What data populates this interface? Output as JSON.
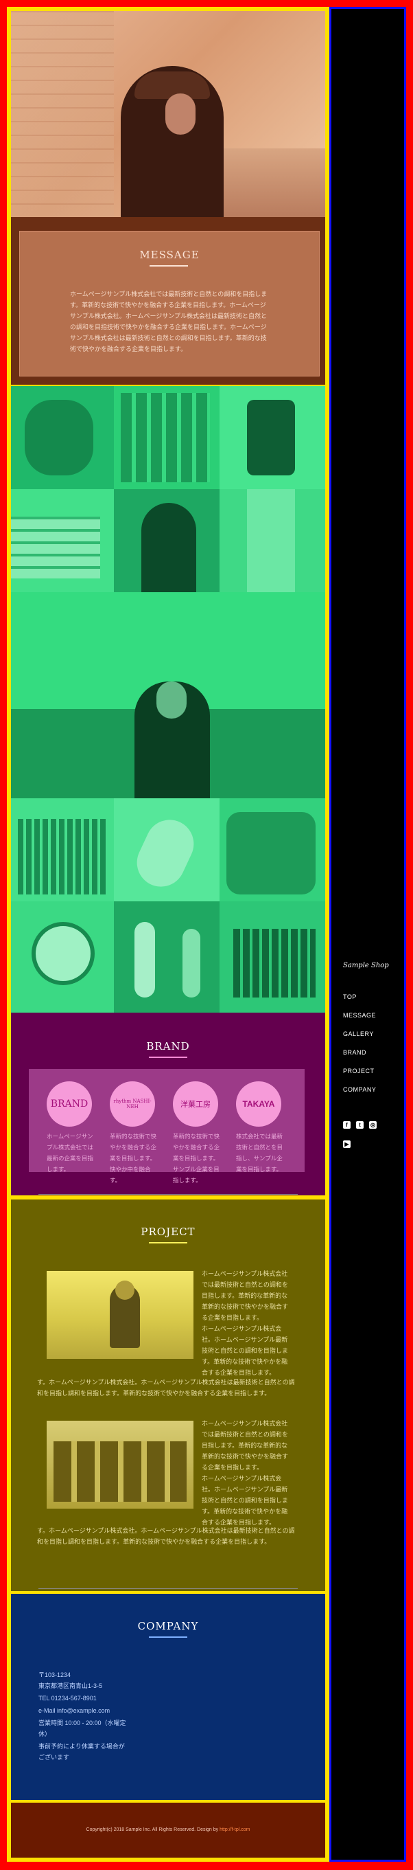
{
  "message": {
    "title": "MESSAGE",
    "body": "ホームページサンプル株式会社では最新技術と自然との調和を目指します。革新的な技術で快やかを融合する企業を目指します。ホームページサンプル株式会社。ホームページサンプル株式会社は最新技術と自然との調和を目指技術で快やかを融合する企業を目指します。ホームページサンプル株式会社は最新技術と自然との調和を目指します。革新的な技術で快やかを融合する企業を目指します。"
  },
  "brand": {
    "title": "BRAND",
    "items": [
      {
        "logo": "BRAND",
        "text": "ホームページサンプル株式会社では最新の企業を目指します。"
      },
      {
        "logo": "rhythm NASHI-NEH",
        "text": "革新的な技術で快やかを融合する企業を目指します。快やか中を融合す。"
      },
      {
        "logo": "洋菓工房",
        "text": "革新的な技術で快やかを融合する企業を目指します。サンプル企業を目指します。"
      },
      {
        "logo": "TAKAYA",
        "text": "株式会社では最新技術と自然とを目指し、サンプル企業を目指します。"
      }
    ]
  },
  "project": {
    "title": "PROJECT",
    "items": [
      {
        "side": "ホームページサンプル株式会社では最新技術と自然との調和を目指します。革新的な革新的な革新的な技術で快やかを融合する企業を目指します。\nホームページサンプル株式会社。ホームページサンプル最新技術と自然との調和を目指します。革新的な技術で快やかを融合する企業を目指します。",
        "full": "す。ホームページサンプル株式会社。ホームページサンプル株式会社は最新技術と自然との調和を目指し調和を目指します。革新的な技術で快やかを融合する企業を目指します。"
      },
      {
        "side": "ホームページサンプル株式会社では最新技術と自然との調和を目指します。革新的な革新的な革新的な技術で快やかを融合する企業を目指します。\nホームページサンプル株式会社。ホームページサンプル最新技術と自然との調和を目指します。革新的な技術で快やかを融合する企業を目指します。",
        "full": "す。ホームページサンプル株式会社。ホームページサンプル株式会社は最新技術と自然との調和を目指し調和を目指します。革新的な技術で快やかを融合する企業を目指します。"
      }
    ]
  },
  "company": {
    "title": "COMPANY",
    "postal": "〒103-1234",
    "address": "東京都港区南青山1-3-5",
    "tel": "TEL 01234-567-8901",
    "email": "e-Mail info@example.com",
    "hours": "営業時間 10:00 - 20:00（水曜定休）",
    "note": "事前予約により休業する場合がございます"
  },
  "footer": {
    "copyright": "Copyright(c) 2018 Sample Inc. All Rights Reserved. Design by",
    "design_link": "http://f-tpl.com"
  },
  "sidebar": {
    "logo": "Sample Shop",
    "nav": [
      "TOP",
      "MESSAGE",
      "GALLERY",
      "BRAND",
      "PROJECT",
      "COMPANY"
    ],
    "social_icons": [
      "facebook-icon",
      "twitter-icon",
      "instagram-icon",
      "youtube-icon"
    ]
  },
  "colors": {
    "outer": "#ff0000",
    "main_frame": "#ffe000",
    "sidebar": "#000000",
    "sidebar_border": "#1010ff",
    "message": "#b5704e",
    "gallery": "#2ee07c",
    "brand": "#64004e",
    "project": "#6b6200",
    "company": "#082d70",
    "footer": "#6a1a00"
  }
}
